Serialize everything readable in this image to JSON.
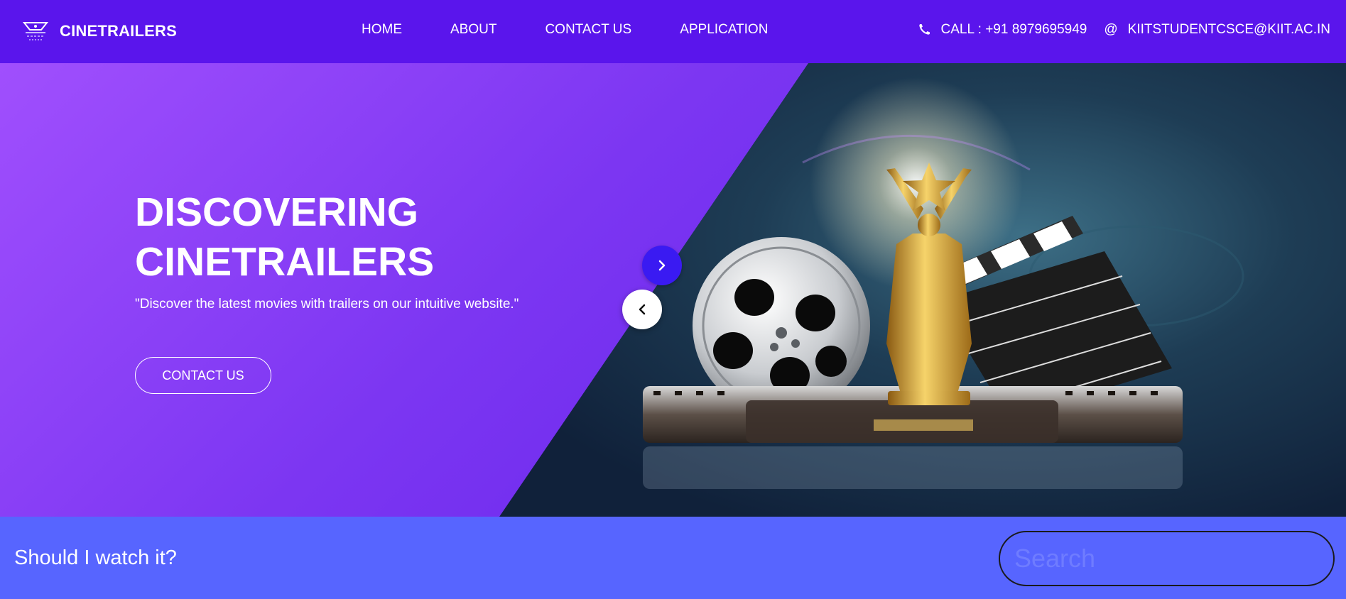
{
  "header": {
    "brand_name": "CINETRAILERS",
    "logo_icon": "film-logo-icon",
    "nav": [
      "HOME",
      "ABOUT",
      "CONTACT US",
      "APPLICATION"
    ],
    "phone_icon": "phone-icon",
    "phone_text": "CALL : +91 8979695949",
    "email_symbol": "@",
    "email_text": "KIITSTUDENTCSCE@KIIT.AC.IN"
  },
  "hero": {
    "title": "DISCOVERING CINETRAILERS",
    "subtitle": "\"Discover the latest movies with trailers on our intuitive website.\"",
    "button_label": "CONTACT US",
    "next_icon": "chevron-right-icon",
    "prev_icon": "chevron-left-icon",
    "image": "film-reel-trophy-clapperboard-illustration"
  },
  "search": {
    "label": "Should I watch it?",
    "placeholder": "Search",
    "value": ""
  },
  "colors": {
    "navbar": "#5a15ec",
    "hero_gradient_start": "#a04ffd",
    "hero_gradient_end": "#5a1be8",
    "search_bar": "#5765ff",
    "next_button": "#3a1af2"
  }
}
